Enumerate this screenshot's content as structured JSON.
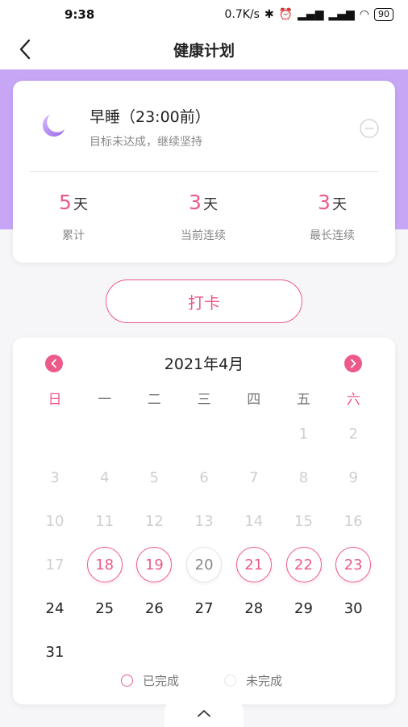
{
  "status_bar": {
    "time": "9:38",
    "speed": "0.7K/s",
    "battery": "90"
  },
  "nav": {
    "title": "健康计划"
  },
  "goal": {
    "title": "早睡（23:00前）",
    "subtitle": "目标未达成，继续坚持",
    "stats": [
      {
        "value": "5",
        "unit": "天",
        "label": "累计"
      },
      {
        "value": "3",
        "unit": "天",
        "label": "当前连续"
      },
      {
        "value": "3",
        "unit": "天",
        "label": "最长连续"
      }
    ]
  },
  "checkin": {
    "label": "打卡"
  },
  "calendar": {
    "title": "2021年4月",
    "weekdays": [
      "日",
      "一",
      "二",
      "三",
      "四",
      "五",
      "六"
    ],
    "days": [
      {
        "n": "1",
        "row": 0,
        "col": 5,
        "state": "past"
      },
      {
        "n": "2",
        "row": 0,
        "col": 6,
        "state": "past"
      },
      {
        "n": "3",
        "row": 1,
        "col": 0,
        "state": "past"
      },
      {
        "n": "4",
        "row": 1,
        "col": 1,
        "state": "past"
      },
      {
        "n": "5",
        "row": 1,
        "col": 2,
        "state": "past"
      },
      {
        "n": "6",
        "row": 1,
        "col": 3,
        "state": "past"
      },
      {
        "n": "7",
        "row": 1,
        "col": 4,
        "state": "past"
      },
      {
        "n": "8",
        "row": 1,
        "col": 5,
        "state": "past"
      },
      {
        "n": "9",
        "row": 1,
        "col": 6,
        "state": "past"
      },
      {
        "n": "10",
        "row": 2,
        "col": 0,
        "state": "past"
      },
      {
        "n": "11",
        "row": 2,
        "col": 1,
        "state": "past"
      },
      {
        "n": "12",
        "row": 2,
        "col": 2,
        "state": "past"
      },
      {
        "n": "13",
        "row": 2,
        "col": 3,
        "state": "past"
      },
      {
        "n": "14",
        "row": 2,
        "col": 4,
        "state": "past"
      },
      {
        "n": "15",
        "row": 2,
        "col": 5,
        "state": "past"
      },
      {
        "n": "16",
        "row": 2,
        "col": 6,
        "state": "past"
      },
      {
        "n": "17",
        "row": 3,
        "col": 0,
        "state": "past"
      },
      {
        "n": "18",
        "row": 3,
        "col": 1,
        "state": "done"
      },
      {
        "n": "19",
        "row": 3,
        "col": 2,
        "state": "done"
      },
      {
        "n": "20",
        "row": 3,
        "col": 3,
        "state": "miss"
      },
      {
        "n": "21",
        "row": 3,
        "col": 4,
        "state": "done"
      },
      {
        "n": "22",
        "row": 3,
        "col": 5,
        "state": "done"
      },
      {
        "n": "23",
        "row": 3,
        "col": 6,
        "state": "done"
      },
      {
        "n": "24",
        "row": 4,
        "col": 0,
        "state": "future"
      },
      {
        "n": "25",
        "row": 4,
        "col": 1,
        "state": "future"
      },
      {
        "n": "26",
        "row": 4,
        "col": 2,
        "state": "future"
      },
      {
        "n": "27",
        "row": 4,
        "col": 3,
        "state": "future"
      },
      {
        "n": "28",
        "row": 4,
        "col": 4,
        "state": "future"
      },
      {
        "n": "29",
        "row": 4,
        "col": 5,
        "state": "future"
      },
      {
        "n": "30",
        "row": 4,
        "col": 6,
        "state": "future"
      },
      {
        "n": "31",
        "row": 5,
        "col": 0,
        "state": "future"
      }
    ],
    "legend": {
      "done": "已完成",
      "miss": "未完成"
    }
  },
  "colors": {
    "accent": "#ec5a8a",
    "band": "#c6a6f5"
  }
}
